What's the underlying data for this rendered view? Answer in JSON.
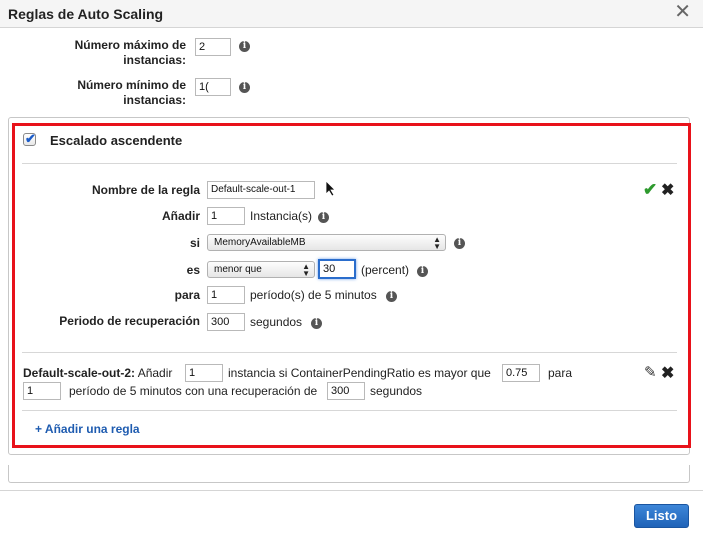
{
  "dialog": {
    "title": "Reglas de Auto Scaling",
    "close_glyph": "✕"
  },
  "limits": {
    "max_label": "Número máximo de instancias:",
    "max_value": "2",
    "min_label": "Número mínimo de instancias:",
    "min_value": "1("
  },
  "scale_up": {
    "checkbox_label": "Escalado ascendente",
    "checked": true
  },
  "rule_form": {
    "name_label": "Nombre de la regla",
    "name_value": "Default-scale-out-1",
    "add_label": "Añadir",
    "add_value": "1",
    "add_unit": "Instancia(s)",
    "if_label": "si",
    "metric_value": "MemoryAvailableMB",
    "is_label": "es",
    "operator_value": "menor que",
    "threshold_value": "30",
    "threshold_unit": "(percent)",
    "for_label": "para",
    "for_value": "1",
    "for_unit": "período(s) de 5 minutos",
    "cooldown_label": "Periodo de recuperación",
    "cooldown_value": "300",
    "cooldown_unit": "segundos",
    "confirm_icon": "check-icon",
    "cancel_icon": "close-icon"
  },
  "existing_rule": {
    "name": "Default-scale-out-2:",
    "text_add": "Añadir",
    "add_value": "1",
    "text_instance_if": "instancia si ContainerPendingRatio es mayor que",
    "threshold_value": "0.75",
    "text_for": "para",
    "period_value": "1",
    "text_period": "período de 5 minutos",
    "text_with_cooldown": "con una recuperación de",
    "cooldown_value": "300",
    "text_seconds": "segundos",
    "edit_icon": "pencil-icon",
    "delete_icon": "close-icon"
  },
  "add_rule_link": "+ Añadir una regla",
  "done_button": "Listo",
  "colors": {
    "highlight": "#e8121a",
    "accent": "#1f63b8",
    "check": "#2e9a2e"
  }
}
